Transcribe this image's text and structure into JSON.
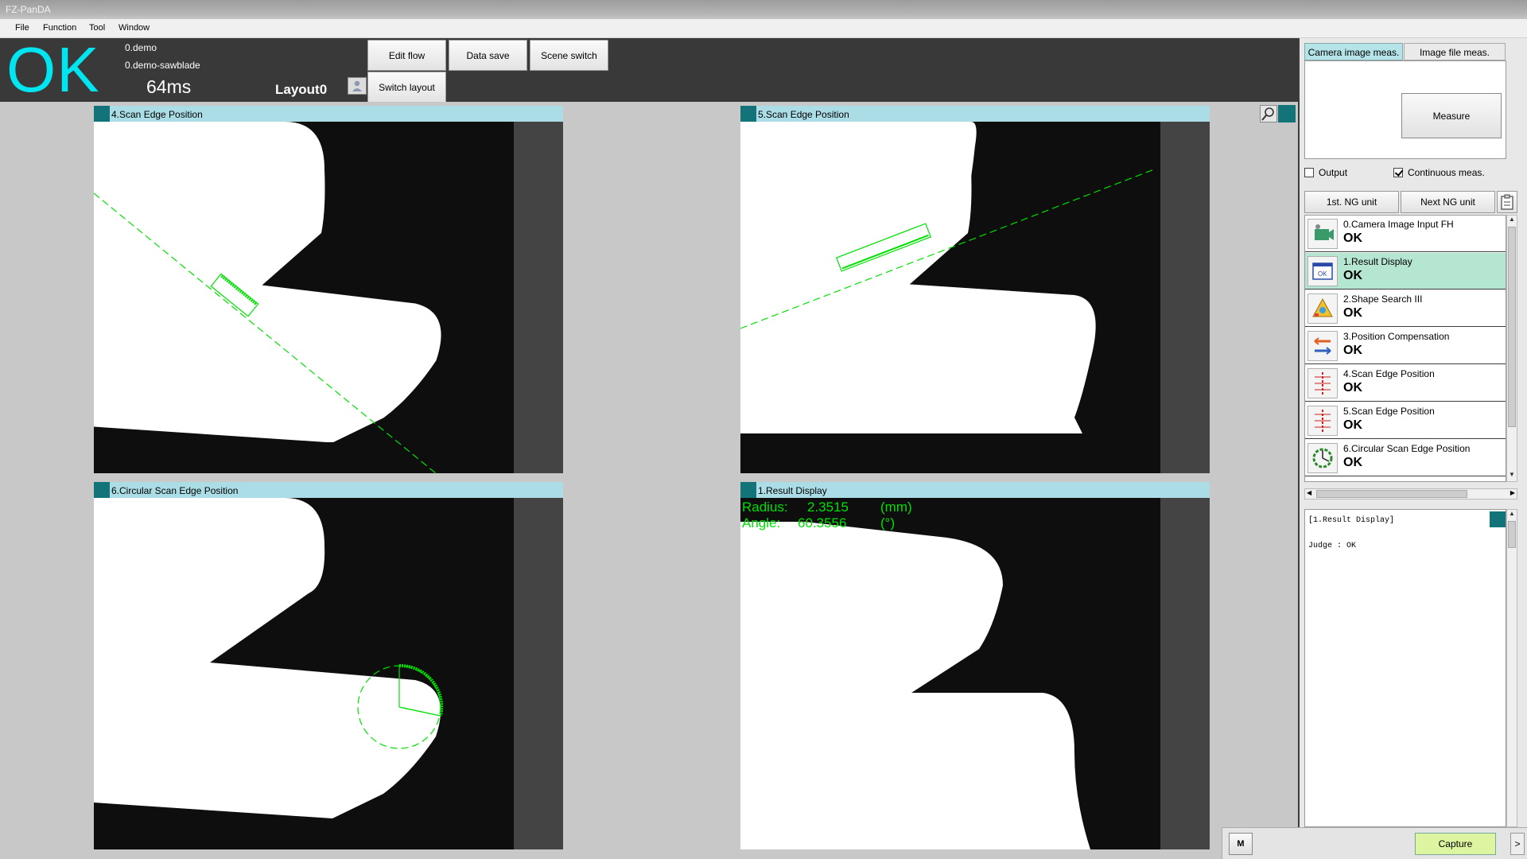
{
  "window": {
    "title": "FZ-PanDA"
  },
  "menu": [
    "File",
    "Function",
    "Tool",
    "Window"
  ],
  "status": {
    "judge": "OK",
    "scene_group": "0.demo",
    "scene": "0.demo-sawblade",
    "time": "64ms",
    "layout": "Layout0"
  },
  "toolbar": {
    "edit_flow": "Edit flow",
    "data_save": "Data save",
    "scene_switch": "Scene switch",
    "switch_layout": "Switch layout"
  },
  "panels": [
    {
      "title": "4.Scan Edge Position"
    },
    {
      "title": "5.Scan Edge Position"
    },
    {
      "title": "6.Circular Scan Edge Position"
    },
    {
      "title": "1.Result Display"
    }
  ],
  "overlay": {
    "radius_label": "Radius:",
    "radius_value": "2.3515",
    "radius_unit": "(mm)",
    "angle_label": "Angle:",
    "angle_value": "60.3556",
    "angle_unit": "(°)",
    "color": "#00e000"
  },
  "right": {
    "tab_camera": "Camera image meas.",
    "tab_file": "Image file meas.",
    "measure": "Measure",
    "output": "Output",
    "continuous": "Continuous meas.",
    "output_checked": false,
    "continuous_checked": true,
    "first_ng": "1st. NG unit",
    "next_ng": "Next NG unit"
  },
  "flow": [
    {
      "name": "0.Camera Image Input FH",
      "status": "OK",
      "icon": "camera-icon"
    },
    {
      "name": "1.Result Display",
      "status": "OK",
      "icon": "result-display-icon"
    },
    {
      "name": "2.Shape Search III",
      "status": "OK",
      "icon": "shape-search-icon"
    },
    {
      "name": "3.Position Compensation",
      "status": "OK",
      "icon": "position-compensation-icon"
    },
    {
      "name": "4.Scan Edge Position",
      "status": "OK",
      "icon": "scan-edge-icon"
    },
    {
      "name": "5.Scan Edge Position",
      "status": "OK",
      "icon": "scan-edge-icon"
    },
    {
      "name": "6.Circular Scan Edge Position",
      "status": "OK",
      "icon": "circular-scan-icon"
    }
  ],
  "detail": {
    "header": "[1.Result Display]",
    "judge_line": "Judge : OK"
  },
  "bottom": {
    "m": "M",
    "capture": "Capture",
    "next": ">"
  },
  "colors": {
    "accent": "#00e5f0",
    "panel_header": "#aadde6",
    "marker": "#127478",
    "selected": "#b4e6d2",
    "capture": "#ddf5a0"
  }
}
